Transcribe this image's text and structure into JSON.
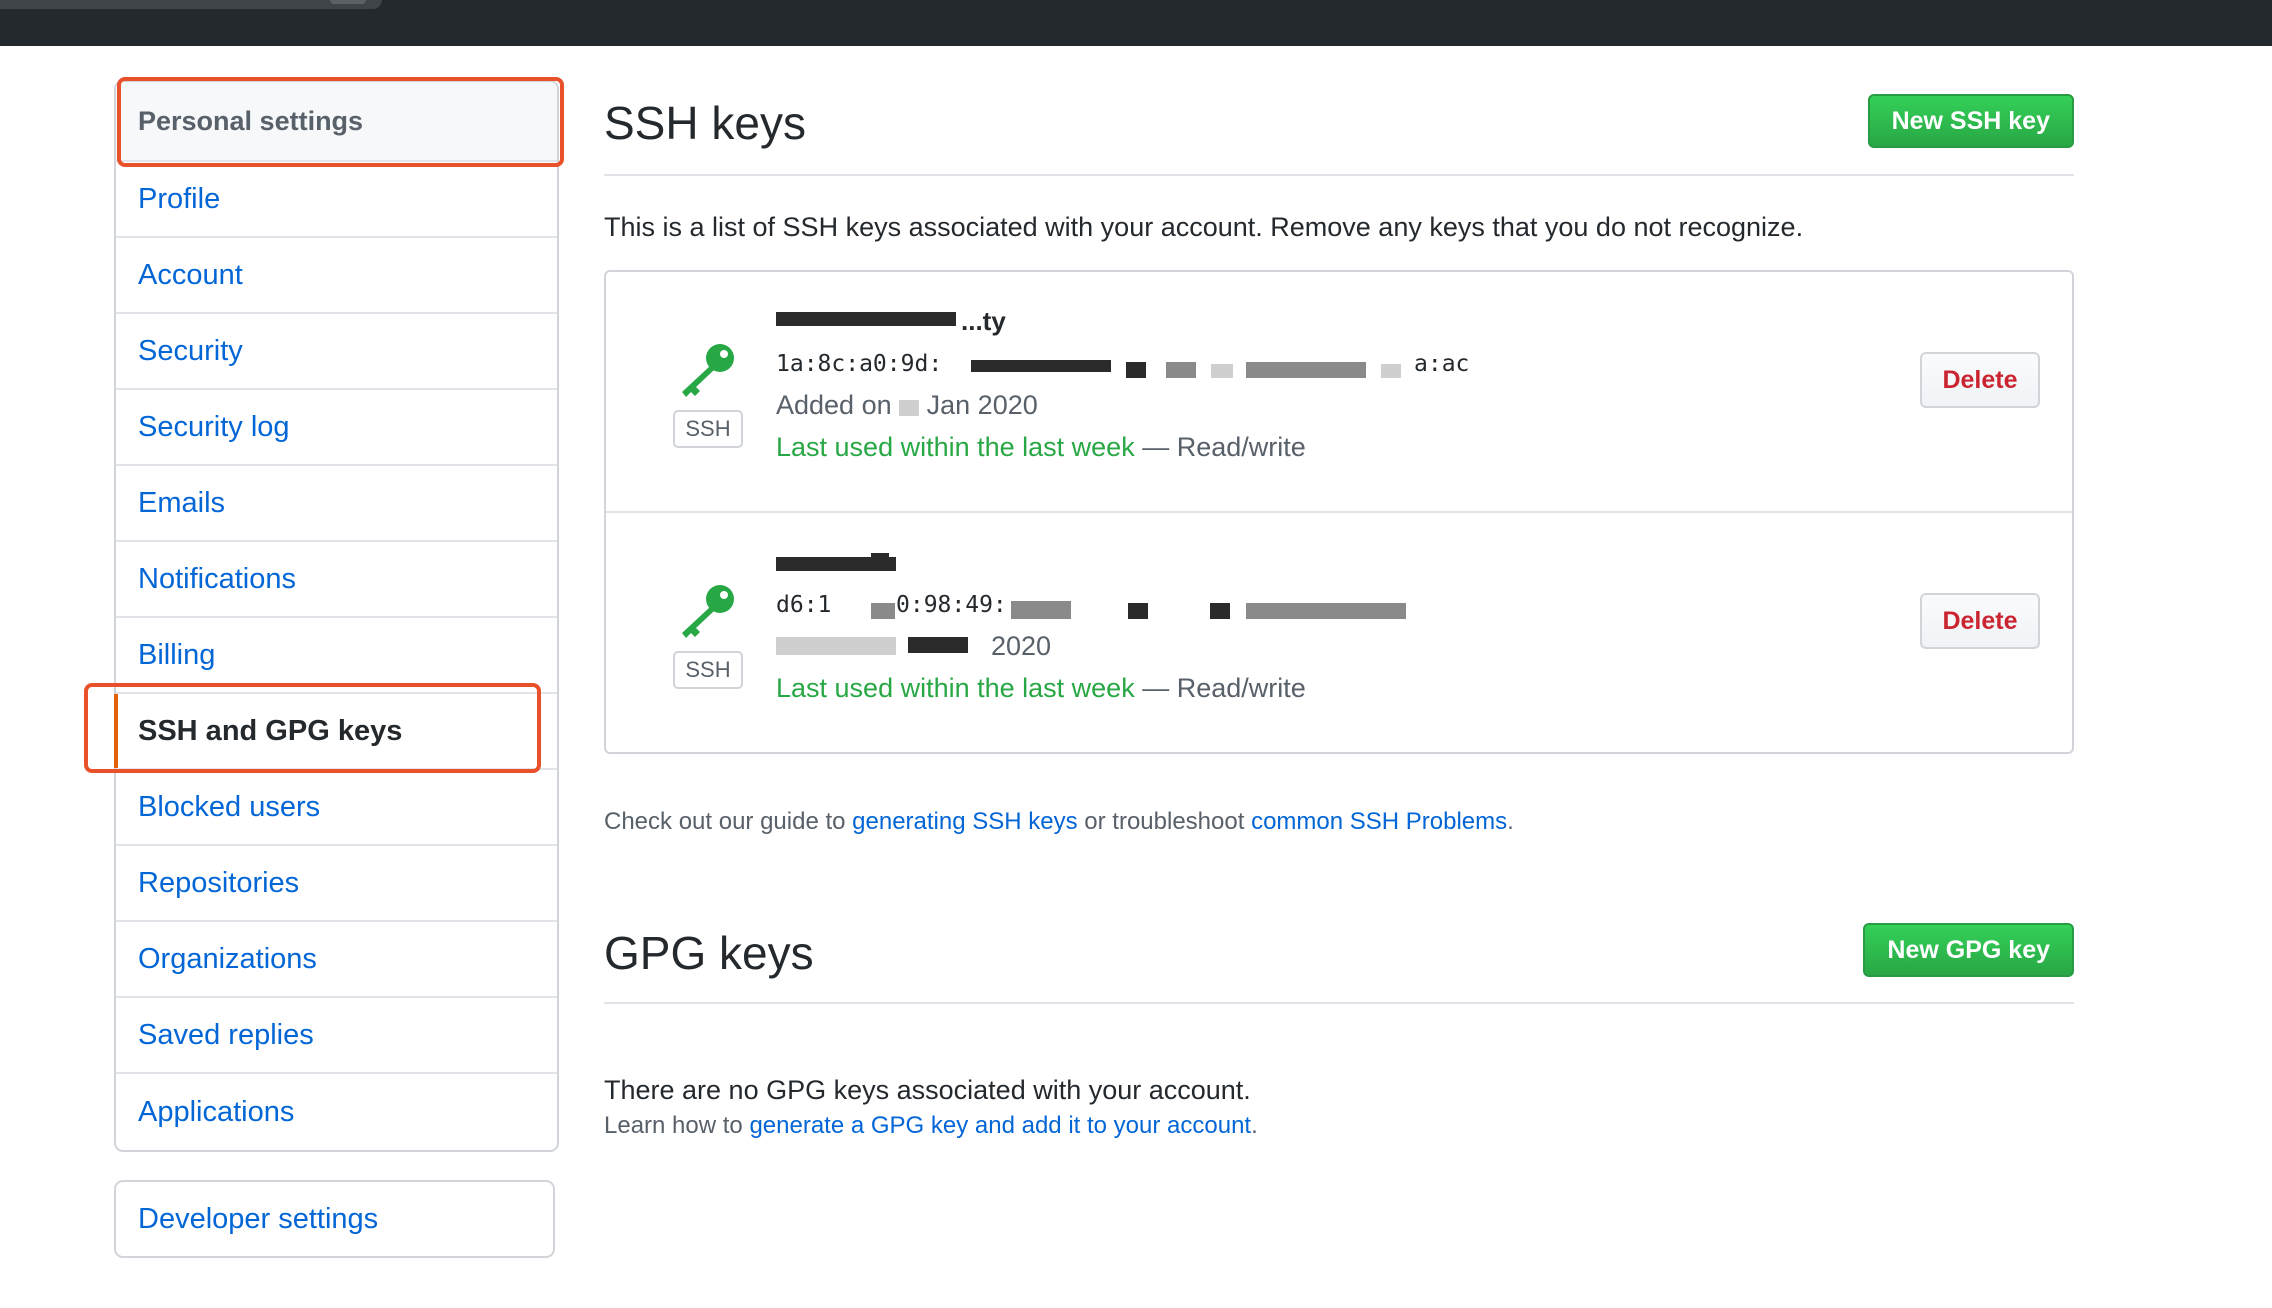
{
  "sidebar": {
    "heading": "Personal settings",
    "items": [
      {
        "label": "Profile"
      },
      {
        "label": "Account"
      },
      {
        "label": "Security"
      },
      {
        "label": "Security log"
      },
      {
        "label": "Emails"
      },
      {
        "label": "Notifications"
      },
      {
        "label": "Billing"
      },
      {
        "label": "SSH and GPG keys",
        "selected": true
      },
      {
        "label": "Blocked users"
      },
      {
        "label": "Repositories"
      },
      {
        "label": "Organizations"
      },
      {
        "label": "Saved replies"
      },
      {
        "label": "Applications"
      }
    ],
    "developer_settings": "Developer settings"
  },
  "ssh": {
    "title": "SSH keys",
    "new_button": "New SSH key",
    "intro": "This is a list of SSH keys associated with your account. Remove any keys that you do not recognize.",
    "keys": [
      {
        "title": "...ty",
        "fingerprint": "1a:8c:a0:9d:",
        "fingerprint_end": "a:ac",
        "added": "Added on",
        "added_date": "Jan 2020",
        "last_used": "Last used within the last week",
        "access": " — Read/write",
        "badge": "SSH",
        "delete": "Delete"
      },
      {
        "title": "",
        "fingerprint": "d6:1",
        "fingerprint_end": "0:98:49:",
        "added": "",
        "added_date": "2020",
        "last_used": "Last used within the last week",
        "access": " — Read/write",
        "badge": "SSH",
        "delete": "Delete"
      }
    ],
    "guide_prefix": "Check out our guide to ",
    "guide_link": "generating SSH keys",
    "guide_middle": " or troubleshoot ",
    "guide_link2": "common SSH Problems",
    "guide_suffix": "."
  },
  "gpg": {
    "title": "GPG keys",
    "new_button": "New GPG key",
    "empty": "There are no GPG keys associated with your account.",
    "learn_prefix": "Learn how to ",
    "learn_link": "generate a GPG key and add it to your account",
    "learn_suffix": "."
  },
  "colors": {
    "accent_green": "#28a745",
    "link_blue": "#0366d6",
    "danger_red": "#cb2431",
    "highlight_orange": "#e8512a",
    "topbar": "#24292e"
  }
}
